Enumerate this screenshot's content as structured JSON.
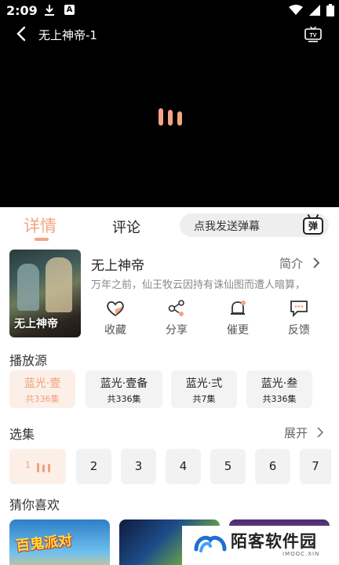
{
  "status_bar": {
    "time": "2:09",
    "a_badge": "A"
  },
  "player": {
    "title": "无上神帝-1"
  },
  "tabs": {
    "detail": "详情",
    "comment": "评论"
  },
  "danmu": {
    "placeholder": "点我发送弹幕",
    "icon_char": "弹"
  },
  "info": {
    "poster_title": "无上神帝",
    "name": "无上神帝",
    "intro_label": "简介",
    "description": "万年之前，仙王牧云因持有诛仙图而遭人暗算，"
  },
  "actions": [
    {
      "label": "收藏",
      "icon": "heart-icon"
    },
    {
      "label": "分享",
      "icon": "share-icon"
    },
    {
      "label": "催更",
      "icon": "bell-icon"
    },
    {
      "label": "反馈",
      "icon": "feedback-icon"
    }
  ],
  "sources": {
    "title": "播放源",
    "items": [
      {
        "name": "蓝光·壹",
        "count": "共336集"
      },
      {
        "name": "蓝光·壹备",
        "count": "共336集"
      },
      {
        "name": "蓝光·弍",
        "count": "共7集"
      },
      {
        "name": "蓝光·叁",
        "count": "共336集"
      }
    ]
  },
  "episodes": {
    "title": "选集",
    "expand_label": "展开",
    "items": [
      "1",
      "2",
      "3",
      "4",
      "5",
      "6",
      "7"
    ]
  },
  "recommend": {
    "title": "猜你喜欢",
    "item1_title": "百鬼派对"
  },
  "watermark": {
    "brand": "陌客软件园",
    "domain": "IMOOC.XIN"
  },
  "colors": {
    "accent": "#f4a582",
    "player_bg": "#000000",
    "chip_bg": "#f3f3f3",
    "chip_active_bg": "#fbefe8"
  }
}
